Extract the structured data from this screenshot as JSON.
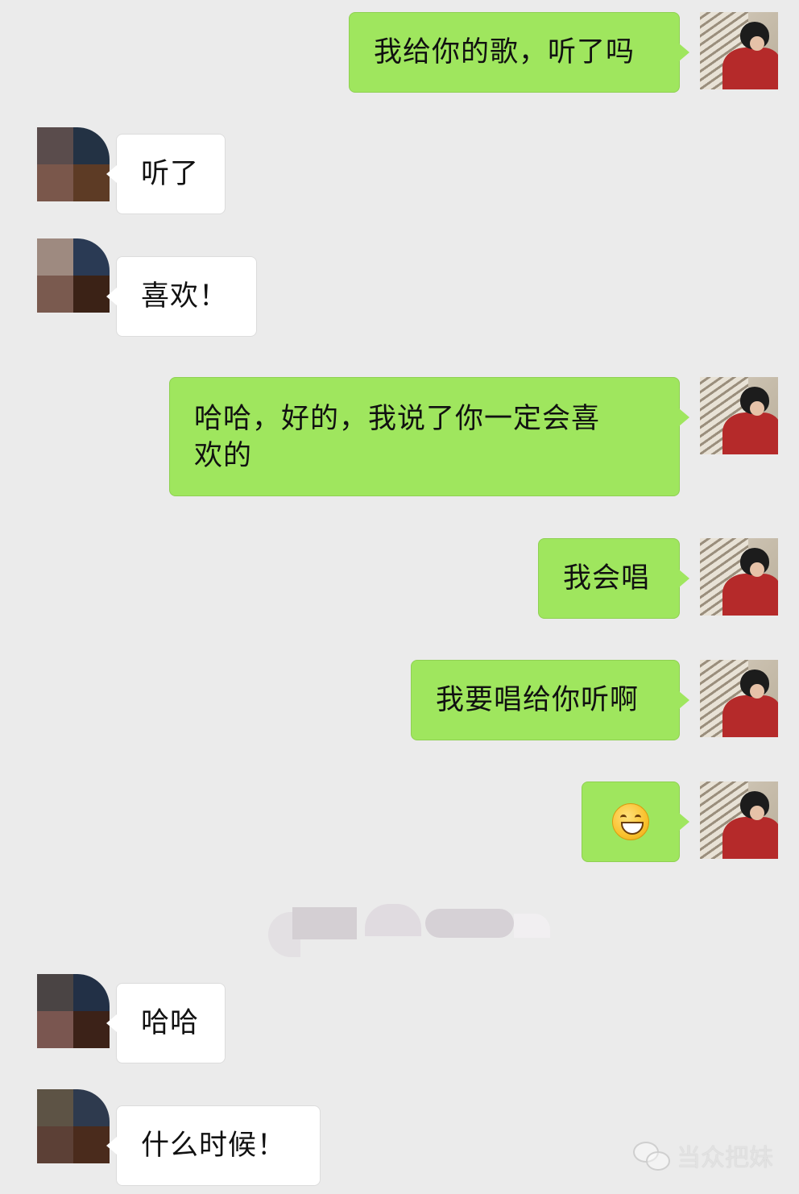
{
  "conversation": {
    "messages": [
      {
        "side": "me",
        "text": "我给你的歌，听了吗"
      },
      {
        "side": "other",
        "text": "听了"
      },
      {
        "side": "other",
        "text": "喜欢！"
      },
      {
        "side": "me",
        "lines": [
          "哈哈，好的，我说了你一定会喜",
          "欢的"
        ]
      },
      {
        "side": "me",
        "text": "我会唱"
      },
      {
        "side": "me",
        "text": "我要唱给你听啊"
      },
      {
        "side": "me",
        "emoji": "grinning-face-emoji"
      },
      {
        "side": "other",
        "text": "哈哈"
      },
      {
        "side": "other",
        "text": "什么时候！"
      }
    ]
  },
  "watermark": {
    "text": "当众把妹",
    "icon": "wechat-icon"
  },
  "colors": {
    "background": "#ebebeb",
    "outgoing_bubble": "#9fe65e",
    "incoming_bubble": "#ffffff"
  }
}
